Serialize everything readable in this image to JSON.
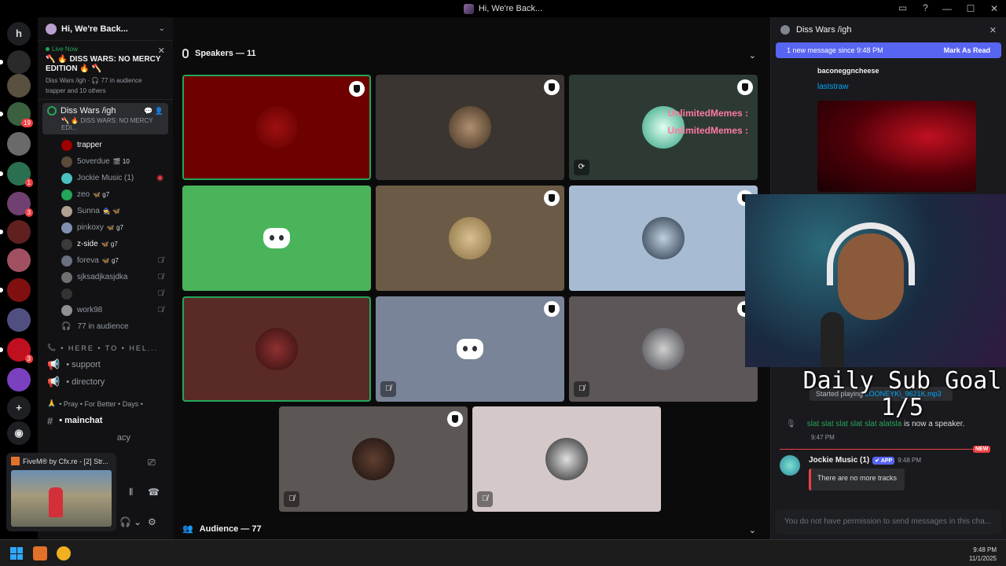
{
  "window": {
    "title": "Hi, We're Back..."
  },
  "server": {
    "name": "Hi, We're Back..."
  },
  "live_event": {
    "status": "Live Now",
    "title": "🪓 🔥 DISS WARS: NO MERCY EDITION 🔥 🪓",
    "channel": "Diss Wars /igh",
    "audience": "77 in audience",
    "attendees": "trapper and 10 others"
  },
  "voice_channel": {
    "name": "Diss Wars /igh",
    "topic": "🪓 🔥 DISS WARS: NO MERCY EDI..."
  },
  "members": [
    {
      "name": "trapper",
      "tag": "",
      "color": "#a00000",
      "bright": true
    },
    {
      "name": "5overdue",
      "tag": "🎬 10",
      "color": "#5a4a3a",
      "bright": false
    },
    {
      "name": "Jockie Music (1)",
      "tag": "",
      "color": "#4ac0c0",
      "bright": false
    },
    {
      "name": "zeo",
      "tag": "🦋 g7",
      "color": "#23a55a",
      "bright": false
    },
    {
      "name": "Sunna",
      "tag": "🧙 🦋",
      "color": "#b0a090",
      "bright": false
    },
    {
      "name": "pinkoxy",
      "tag": "🦋 g7",
      "color": "#8090b0",
      "bright": false
    },
    {
      "name": "z-side",
      "tag": "🦋 g7",
      "color": "#3a3a3a",
      "bright": true
    },
    {
      "name": "foreva",
      "tag": "🦋 g7",
      "color": "#6a7080",
      "bright": false
    },
    {
      "name": "sjksadjkasjdka",
      "tag": "",
      "color": "#707070",
      "bright": false
    },
    {
      "name": "",
      "tag": "",
      "color": "#333333",
      "bright": false
    },
    {
      "name": "work98",
      "tag": "",
      "color": "#909090",
      "bright": false
    }
  ],
  "audience_row": "77 in audience",
  "categories": {
    "here_to_help": "• HERE • TO • HEL...",
    "pray": "• Pray • For Better • Days •"
  },
  "channels": {
    "support": "• support",
    "directory": "• directory",
    "mainchat": "• mainchat",
    "privacy_partial": "acy"
  },
  "pip": {
    "title": "FiveM® by Cfx.re - [2] Str..."
  },
  "stage": {
    "speakers_header": "Speakers — 11",
    "audience_header": "Audience — 77",
    "overlay_name": "UnlimitedMemes :",
    "tile_colors": [
      "#6e0000",
      "#3a3530",
      "#2d3a34",
      "#4ab45a",
      "#6b5a46",
      "#a7bcd2",
      "#5a2a26",
      "#7a8498",
      "#5c5658",
      "#5c5654",
      "#d4c8c8"
    ]
  },
  "right_panel": {
    "thread_title": "Diss Wars /igh",
    "new_message": "1 new message since 9:48 PM",
    "mark_read": "Mark As Read",
    "prev_author": "baconeggncheese",
    "prev_link": "laststraw"
  },
  "overlay": {
    "goal_line1": "Daily Sub Goal",
    "goal_line2": "1/5"
  },
  "messages": {
    "started_playing": "Started playing",
    "track": "LOONEYK\\_9621K.mp3",
    "speaker_names": "slat slat slat slat slat alatsla",
    "speaker_suffix": " is now a speaker.",
    "speaker_time": "9:47 PM",
    "new_label": "NEW",
    "bot_name": "Jockie Music (1)",
    "bot_badge": "✔ APP",
    "bot_time": "9:48 PM",
    "bot_text": "There are no more tracks",
    "input_placeholder": "You do not have permission to send messages in this cha..."
  },
  "taskbar": {
    "time": "9:48 PM",
    "date": "11/1/2025"
  },
  "colors": {
    "accent": "#5865f2",
    "speaking": "#23a55a",
    "danger": "#f23f43"
  }
}
